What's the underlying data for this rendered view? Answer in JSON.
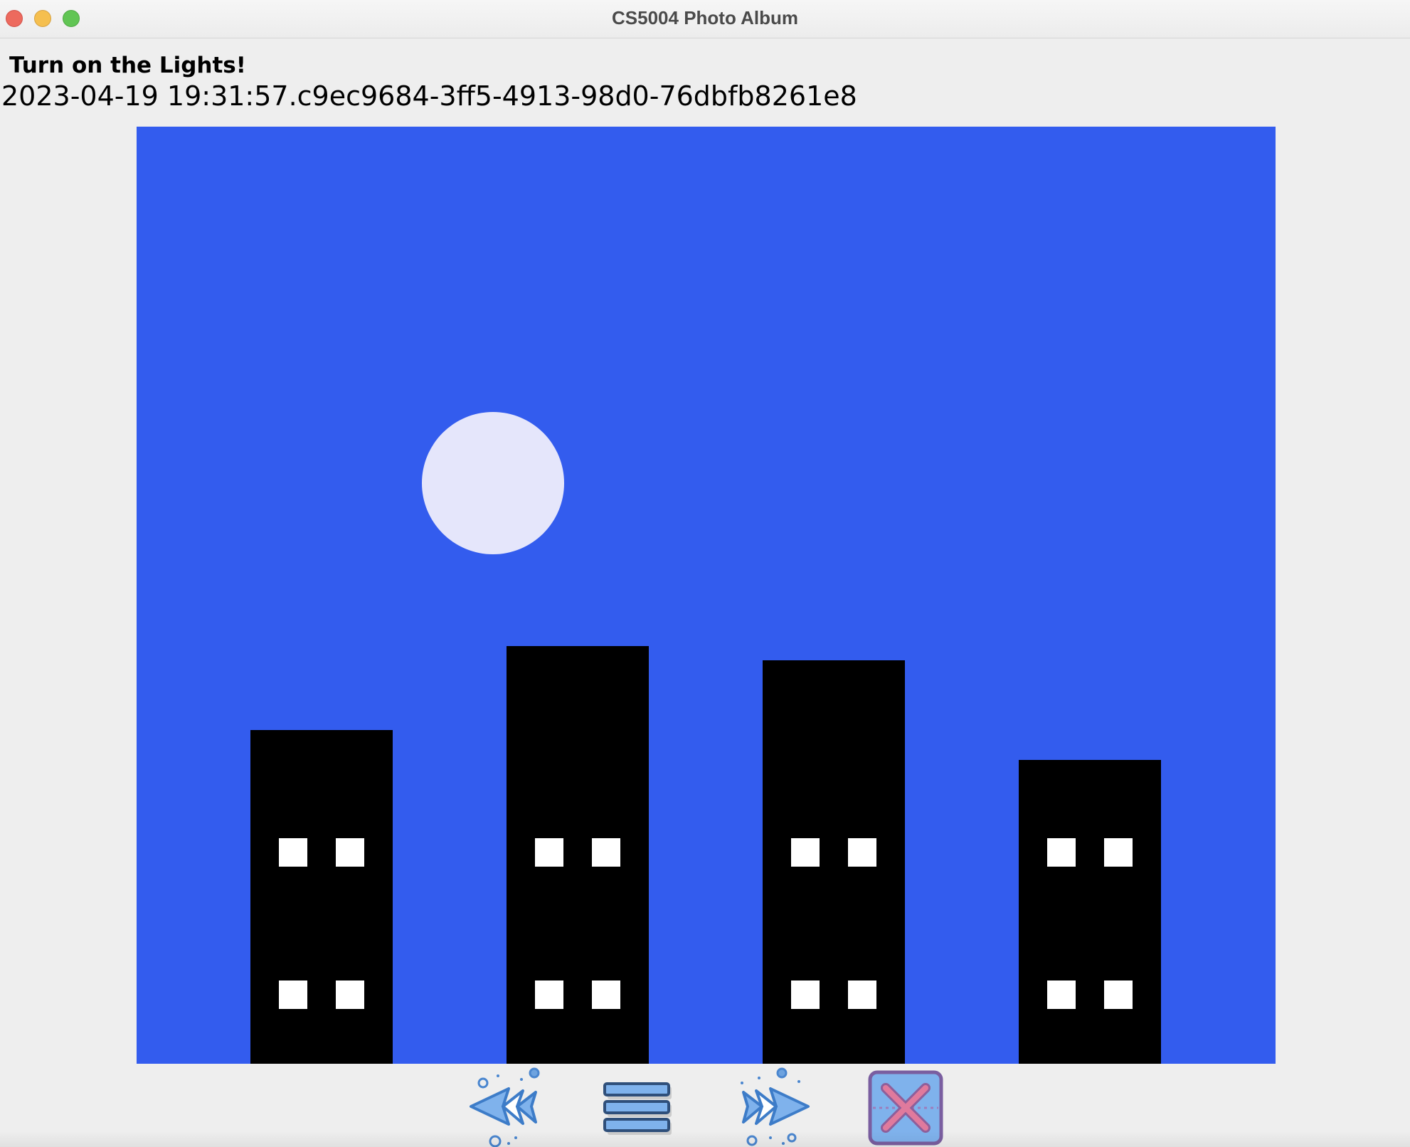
{
  "window": {
    "title": "CS5004 Photo Album"
  },
  "photo": {
    "title": "Turn on the Lights!",
    "id": "2023-04-19 19:31:57.c9ec9684-3ff5-4913-98d0-76dbfb8261e8"
  },
  "colors": {
    "sky": "#335cee",
    "moon": "#e5e6fb",
    "building": "#000000",
    "window_light": "#ffffff"
  },
  "scene": {
    "building_count": 4,
    "windows_per_building": 4
  },
  "toolbar": {
    "prev_icon": "rewind-arrows-icon",
    "menu_icon": "menu-list-icon",
    "next_icon": "forward-arrows-icon",
    "exit_icon": "close-x-icon"
  }
}
